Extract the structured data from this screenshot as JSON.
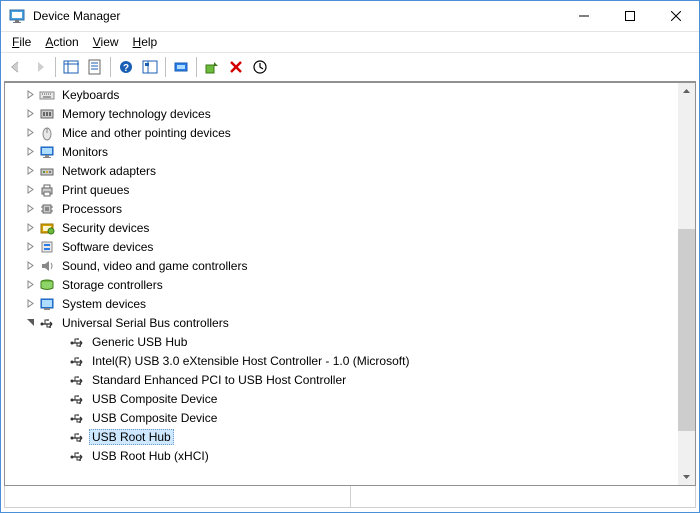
{
  "titlebar": {
    "title": "Device Manager"
  },
  "menu": {
    "file": "File",
    "action": "Action",
    "view": "View",
    "help": "Help"
  },
  "tree": {
    "categories": [
      {
        "label": "Keyboards",
        "expanded": false,
        "icon": "keyboard"
      },
      {
        "label": "Memory technology devices",
        "expanded": false,
        "icon": "memory"
      },
      {
        "label": "Mice and other pointing devices",
        "expanded": false,
        "icon": "mouse"
      },
      {
        "label": "Monitors",
        "expanded": false,
        "icon": "monitor"
      },
      {
        "label": "Network adapters",
        "expanded": false,
        "icon": "network"
      },
      {
        "label": "Print queues",
        "expanded": false,
        "icon": "printer"
      },
      {
        "label": "Processors",
        "expanded": false,
        "icon": "cpu"
      },
      {
        "label": "Security devices",
        "expanded": false,
        "icon": "security"
      },
      {
        "label": "Software devices",
        "expanded": false,
        "icon": "software"
      },
      {
        "label": "Sound, video and game controllers",
        "expanded": false,
        "icon": "sound"
      },
      {
        "label": "Storage controllers",
        "expanded": false,
        "icon": "storage"
      },
      {
        "label": "System devices",
        "expanded": false,
        "icon": "system"
      },
      {
        "label": "Universal Serial Bus controllers",
        "expanded": true,
        "icon": "usb",
        "children": [
          {
            "label": "Generic USB Hub",
            "icon": "usb",
            "selected": false
          },
          {
            "label": "Intel(R) USB 3.0 eXtensible Host Controller - 1.0 (Microsoft)",
            "icon": "usb",
            "selected": false
          },
          {
            "label": "Standard Enhanced PCI to USB Host Controller",
            "icon": "usb",
            "selected": false
          },
          {
            "label": "USB Composite Device",
            "icon": "usb",
            "selected": false
          },
          {
            "label": "USB Composite Device",
            "icon": "usb",
            "selected": false
          },
          {
            "label": "USB Root Hub",
            "icon": "usb",
            "selected": true
          },
          {
            "label": "USB Root Hub (xHCI)",
            "icon": "usb",
            "selected": false
          }
        ]
      }
    ]
  }
}
